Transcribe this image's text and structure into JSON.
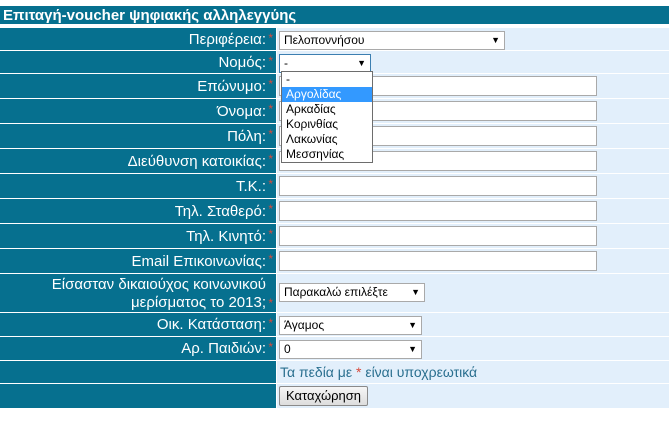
{
  "form_title": "Επιταγή-voucher ψηφιακής αλληλεγγύης",
  "required_mark": "*",
  "fields": [
    {
      "label": "Περιφέρεια:",
      "type": "select",
      "value": "Πελοποννήσου"
    },
    {
      "label": "Νομός:",
      "type": "select",
      "value": "-"
    },
    {
      "label": "Επώνυμο:",
      "type": "text",
      "value": ""
    },
    {
      "label": "Όνομα:",
      "type": "text",
      "value": ""
    },
    {
      "label": "Πόλη:",
      "type": "text",
      "value": ""
    },
    {
      "label": "Διεύθυνση κατοικίας:",
      "type": "text",
      "value": ""
    },
    {
      "label": "Τ.Κ.:",
      "type": "text",
      "value": ""
    },
    {
      "label": "Τηλ. Σταθερό:",
      "type": "text",
      "value": ""
    },
    {
      "label": "Τηλ. Κινητό:",
      "type": "text",
      "value": ""
    },
    {
      "label": "Email Επικοινωνίας:",
      "type": "text",
      "value": ""
    },
    {
      "label_line1": "Είσασταν δικαιούχος κοινωνικού",
      "label_line2": "μερίσματος το 2013;",
      "type": "select",
      "value": "Παρακαλώ επιλέξτε"
    },
    {
      "label": "Οικ. Κατάσταση:",
      "type": "select",
      "value": "Άγαμος"
    },
    {
      "label": "Αρ. Παιδιών:",
      "type": "select",
      "value": "0"
    }
  ],
  "nomos_dropdown": {
    "options": [
      "-",
      "Αργολίδας",
      "Αρκαδίας",
      "Κορινθίας",
      "Λακωνίας",
      "Μεσσηνίας"
    ],
    "highlighted": "Αργολίδας"
  },
  "required_note": {
    "before": "Τα πεδία με",
    "star": "*",
    "after": "είναι υποχρεωτικά"
  },
  "submit_label": "Καταχώρηση",
  "colors": {
    "label_bg": "#06708f",
    "value_bg": "#e2effb",
    "required": "#d8493a",
    "highlight": "#3399ff"
  }
}
